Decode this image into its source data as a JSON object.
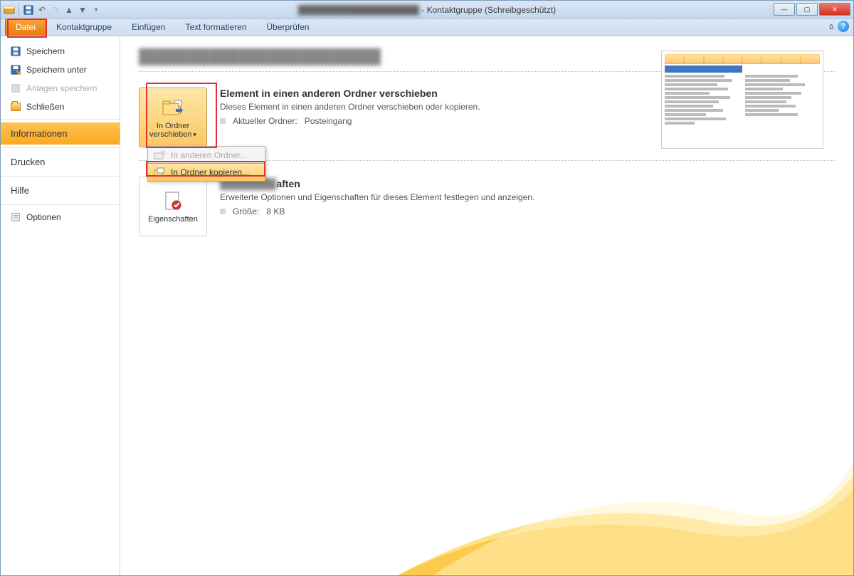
{
  "title": {
    "suffix": " - Kontaktgruppe  (Schreibgeschützt)"
  },
  "ribbon": {
    "file": "Datei",
    "tabs": [
      "Kontaktgruppe",
      "Einfügen",
      "Text formatieren",
      "Überprüfen"
    ]
  },
  "left_pane": {
    "save": "Speichern",
    "save_as": "Speichern unter",
    "save_attachments": "Anlagen speichern",
    "close": "Schließen",
    "info": "Informationen",
    "print": "Drucken",
    "help": "Hilfe",
    "options": "Optionen"
  },
  "content": {
    "move": {
      "button": "In Ordner verschieben",
      "heading": "Element in einen anderen Ordner verschieben",
      "desc": "Dieses Element in einen anderen Ordner verschieben oder kopieren.",
      "current_label": "Aktueller Ordner:",
      "current_value": "Posteingang"
    },
    "props": {
      "button": "Eigenschaften",
      "heading_suffix": "aften",
      "desc": "Erweiterte Optionen und Eigenschaften für dieses Element festlegen und anzeigen.",
      "size_label": "Größe:",
      "size_value": "8 KB"
    }
  },
  "dropdown": {
    "other": "In anderen Ordner...",
    "copy": "In Ordner kopieren..."
  }
}
